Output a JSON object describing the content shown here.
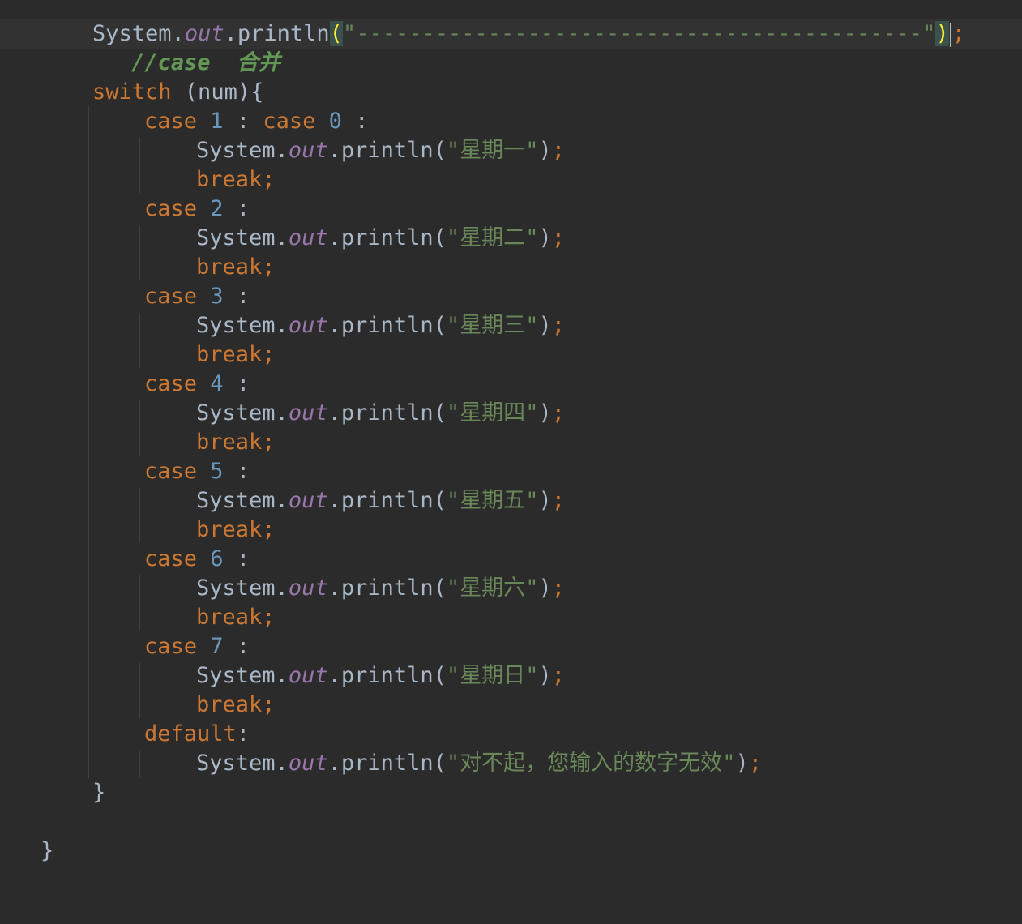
{
  "editor": {
    "language": "Java",
    "colors": {
      "background": "#2b2b2b",
      "current_line": "#323232",
      "keyword": "#cc7832",
      "number": "#6897bb",
      "string": "#6a8759",
      "field": "#9876aa",
      "comment": "#629755",
      "matched_paren": "#ffef28"
    },
    "tok": {
      "system": "System",
      "dot": ".",
      "out": "out",
      "println": "println",
      "open": "(",
      "close": ")",
      "semi": ";",
      "quote": "\"",
      "case": "case",
      "colon": " :",
      "break": "break",
      "switch": "switch",
      "switch_arg": " (num){",
      "default": "default",
      "default_colon": ":",
      "close_brace": "}",
      "case_sep": " : "
    },
    "line1_dashes": "-------------------------------------------",
    "comment_text": "//case  合并",
    "cases": [
      {
        "labels": [
          "1",
          "0"
        ],
        "text": "星期一"
      },
      {
        "labels": [
          "2"
        ],
        "text": "星期二"
      },
      {
        "labels": [
          "3"
        ],
        "text": "星期三"
      },
      {
        "labels": [
          "4"
        ],
        "text": "星期四"
      },
      {
        "labels": [
          "5"
        ],
        "text": "星期五"
      },
      {
        "labels": [
          "6"
        ],
        "text": "星期六"
      },
      {
        "labels": [
          "7"
        ],
        "text": "星期日"
      }
    ],
    "default_text": "对不起，您输入的数字无效"
  }
}
